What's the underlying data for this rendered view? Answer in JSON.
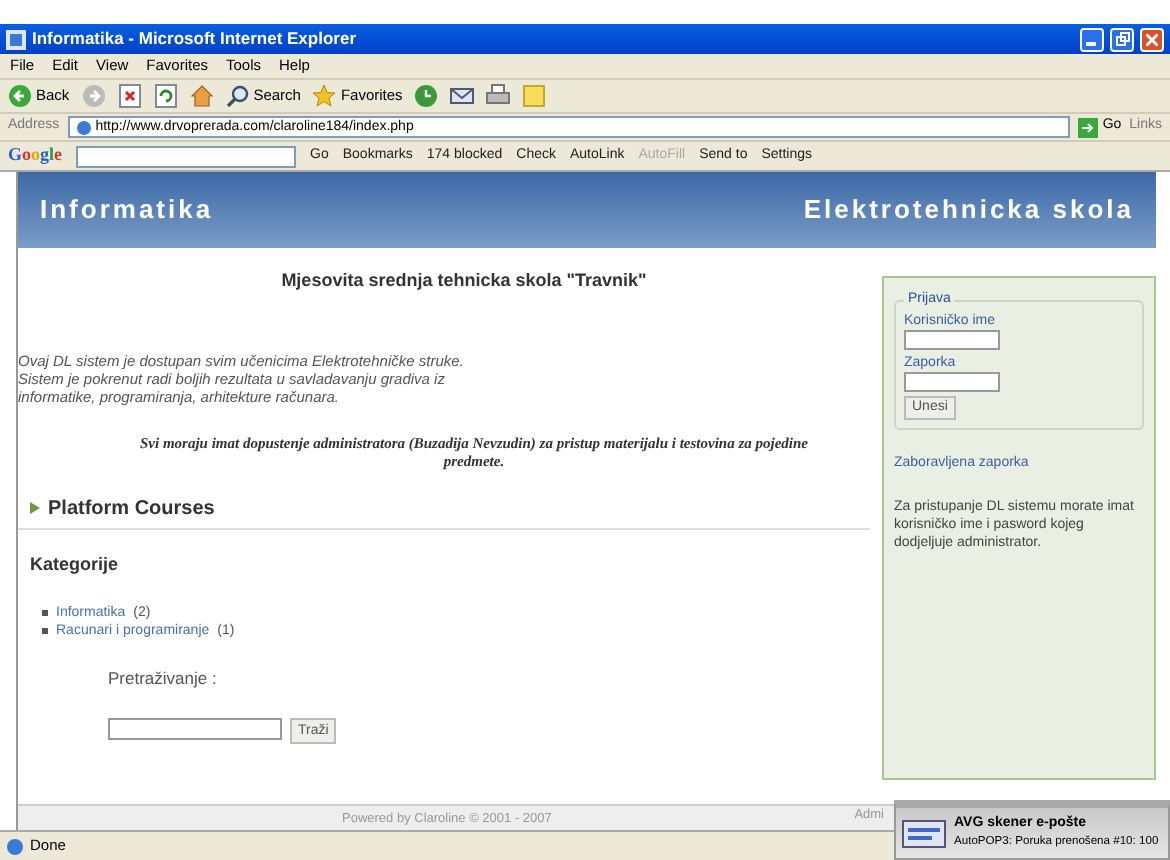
{
  "window": {
    "title": "Informatika - Microsoft Internet Explorer"
  },
  "menu": [
    "File",
    "Edit",
    "View",
    "Favorites",
    "Tools",
    "Help"
  ],
  "toolbar": [
    {
      "kind": "back",
      "label": "Back"
    },
    {
      "kind": "forward"
    },
    {
      "kind": "stop"
    },
    {
      "kind": "refresh"
    },
    {
      "kind": "home"
    },
    {
      "kind": "search",
      "label": "Search"
    },
    {
      "kind": "favorites",
      "label": "Favorites"
    },
    {
      "kind": "history"
    },
    {
      "kind": "mail"
    },
    {
      "kind": "print"
    },
    {
      "kind": "note"
    }
  ],
  "address": {
    "label": "Address",
    "url": "http://www.drvoprerada.com/claroline184/index.php",
    "go": "Go",
    "links": "Links"
  },
  "google_bar": {
    "logo": "Google",
    "items": [
      {
        "label": "Go",
        "disabled": false
      },
      {
        "label": "Bookmarks",
        "disabled": false
      },
      {
        "label": "174 blocked",
        "disabled": false
      },
      {
        "label": "Check",
        "disabled": false
      },
      {
        "label": "AutoLink",
        "disabled": false
      },
      {
        "label": "AutoFill",
        "disabled": true
      },
      {
        "label": "Send to",
        "disabled": false
      },
      {
        "label": "Settings",
        "disabled": false
      }
    ]
  },
  "header": {
    "left": "Informatika",
    "right": "Elektrotehnicka skola"
  },
  "main": {
    "title": "Mjesovita srednja tehnicka skola \"Travnik\"",
    "intro": [
      "Ovaj DL sistem je dostupan svim učenicima Elektrotehničke struke.",
      "Sistem je pokrenut radi boljih rezultata u savladavanju gradiva iz",
      "informatike, programiranja, arhitekture računara."
    ],
    "notice": "Svi moraju imat dopustenje administratora (Buzadija Nevzudin) za pristup materijalu i testovina za pojedine predmete.",
    "courses_heading": "Platform Courses",
    "categories_heading": "Kategorije",
    "categories": [
      {
        "name": "Informatika",
        "count": "(2)"
      },
      {
        "name": "Racunari i programiranje",
        "count": "(1)"
      }
    ],
    "search_label": "Pretraživanje :",
    "search_button": "Traži"
  },
  "login": {
    "legend": "Prijava",
    "username_label": "Korisničko ime",
    "password_label": "Zaporka",
    "submit": "Unesi",
    "forgot": "Zaboravljena zaporka",
    "info": "Za pristupanje DL sistemu morate imat korisničko ime i pasword kojeg dodjeljuje administrator."
  },
  "footer": {
    "powered": "Powered by Claroline © 2001 - 2007",
    "admin": "Admi"
  },
  "status_bar": {
    "text": "Done"
  },
  "notification": {
    "title": "AVG skener e-pošte",
    "message": "AutoPOP3: Poruka prenošena #10: 100"
  }
}
